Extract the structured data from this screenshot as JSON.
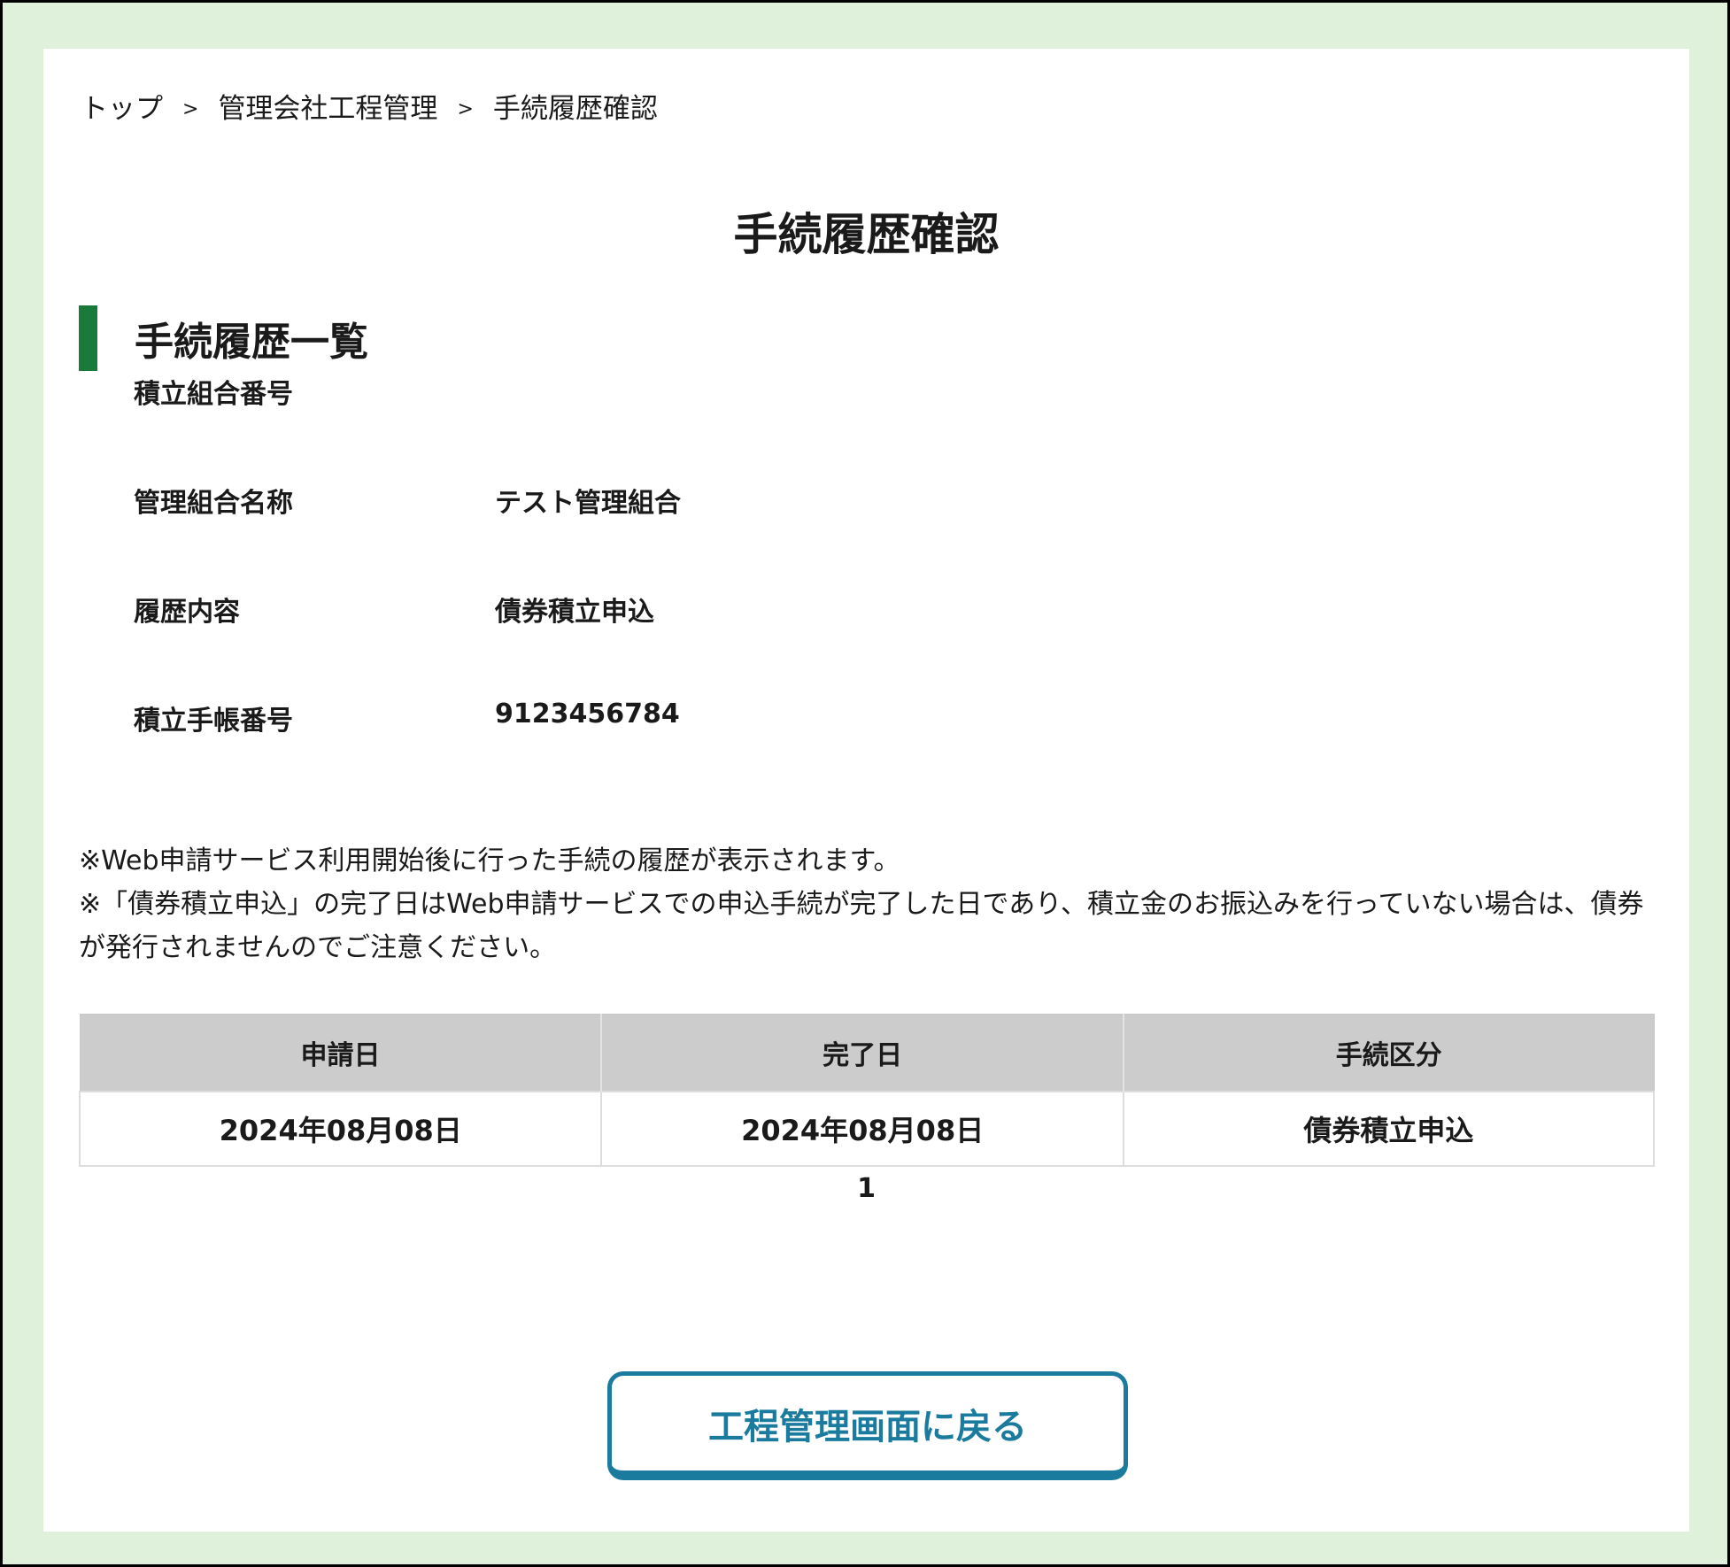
{
  "breadcrumb": {
    "items": [
      "トップ",
      "管理会社工程管理",
      "手続履歴確認"
    ],
    "separator": ">"
  },
  "page_title": "手続履歴確認",
  "section_title": "手続履歴一覧",
  "fields": [
    {
      "label": "積立組合番号",
      "value": ""
    },
    {
      "label": "管理組合名称",
      "value": "テスト管理組合"
    },
    {
      "label": "履歴内容",
      "value": "債券積立申込"
    },
    {
      "label": "積立手帳番号",
      "value": "9123456784"
    }
  ],
  "notes": [
    "※Web申請サービス利用開始後に行った手続の履歴が表示されます。",
    "※「債券積立申込」の完了日はWeb申請サービスでの申込手続が完了した日であり、積立金のお振込みを行っていない場合は、債券が発行されませんのでご注意ください。"
  ],
  "table": {
    "headers": [
      "申請日",
      "完了日",
      "手続区分"
    ],
    "rows": [
      [
        "2024年08月08日",
        "2024年08月08日",
        "債券積立申込"
      ]
    ]
  },
  "pagination": {
    "current": "1"
  },
  "back_button_label": "工程管理画面に戻る",
  "colors": {
    "frame_bg": "#dff0db",
    "section_accent": "#1a7a3a",
    "button_accent": "#1a7b9e",
    "table_header_bg": "#cccccc"
  }
}
